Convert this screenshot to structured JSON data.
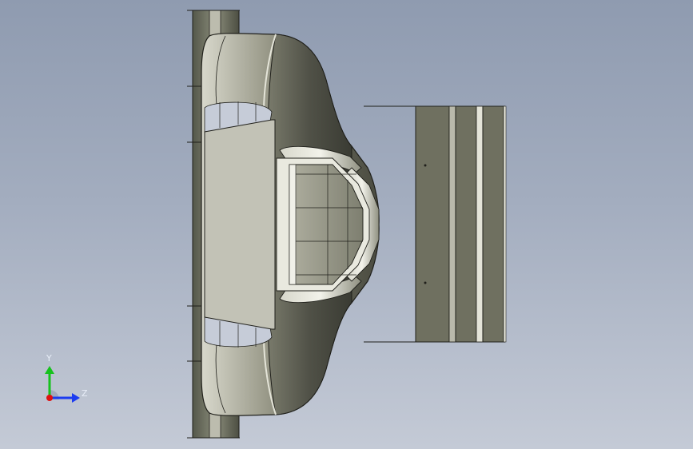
{
  "viewport": {
    "background_top": "#8f9bb0",
    "background_bottom": "#c4cad6"
  },
  "model": {
    "body_color": "#6f7060",
    "panel_color": "#c2c2b6",
    "edge_color": "#1f1f1a",
    "highlight_color": "#e4e4d8"
  },
  "triad": {
    "y_label": "Y",
    "z_label": "Z",
    "y_color": "#16c21d",
    "z_color": "#1c3cf0",
    "x_color": "#e01010"
  }
}
